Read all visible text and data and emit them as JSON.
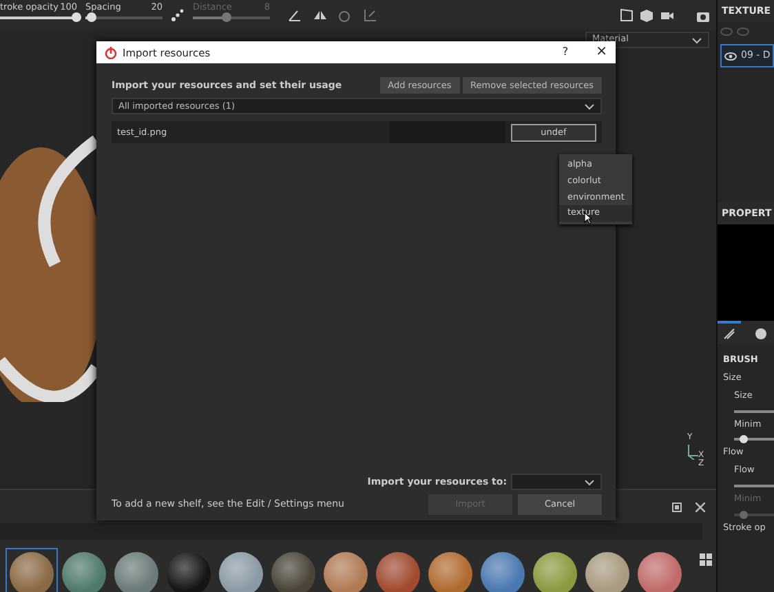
{
  "toolbar": {
    "sliders": [
      {
        "label": "troke opacity",
        "value": "100",
        "level": 0.98,
        "disabled": false
      },
      {
        "label": "Spacing",
        "value": "20",
        "level": 0.08,
        "disabled": false
      },
      {
        "label": "Distance",
        "value": "8",
        "level": 0.42,
        "disabled": true
      }
    ]
  },
  "material_select": {
    "value": "Material"
  },
  "axis_gizmo": {
    "labels": [
      "Y",
      "X",
      "Z"
    ]
  },
  "texture_panel": {
    "title": "TEXTURE",
    "layers": [
      {
        "label": "09 - D",
        "selected": true
      }
    ]
  },
  "properties_panel": {
    "title": "PROPERT",
    "tabs": [
      {
        "kind": "brush",
        "selected": true
      },
      {
        "kind": "material",
        "selected": false
      }
    ],
    "section": "BRUSH",
    "params": [
      {
        "kind": "group",
        "label": "Size"
      },
      {
        "kind": "slider",
        "label": "Size",
        "disabled": false
      },
      {
        "kind": "slider",
        "label": "Minim",
        "level": 0.25,
        "disabled": false
      },
      {
        "kind": "group",
        "label": "Flow"
      },
      {
        "kind": "slider",
        "label": "Flow",
        "disabled": false
      },
      {
        "kind": "slider",
        "label": "Minim",
        "level": 0.25,
        "disabled": true
      },
      {
        "kind": "group",
        "label": "Stroke op"
      }
    ]
  },
  "dialog": {
    "title": "Import resources",
    "help": "?",
    "close": "×",
    "heading": "Import your resources and set their usage",
    "buttons": [
      {
        "label": "Add resources"
      },
      {
        "label": "Remove selected resources"
      }
    ],
    "filter": {
      "value": "All imported resources (1)"
    },
    "resources": [
      {
        "name": "test_id.png",
        "usage": "undef"
      }
    ],
    "usage_menu": [
      {
        "label": "alpha",
        "selected": false
      },
      {
        "label": "colorlut",
        "selected": false
      },
      {
        "label": "environment",
        "selected": false
      },
      {
        "label": "texture",
        "selected": true
      }
    ],
    "destination_label": "Import your resources to:",
    "hint": "To add a new shelf, see the Edit / Settings menu",
    "actions": [
      {
        "label": "Import",
        "disabled": true
      },
      {
        "label": "Cancel",
        "disabled": false
      }
    ]
  },
  "shelf": {
    "materials": [
      {
        "color": "#8a6a45",
        "selected": true
      },
      {
        "color": "#4f7a6a",
        "selected": false
      },
      {
        "color": "#6a7a78",
        "selected": false
      },
      {
        "color": "#151515",
        "selected": false
      },
      {
        "color": "#8a9aa5",
        "selected": false
      },
      {
        "color": "#4a4438",
        "selected": false
      },
      {
        "color": "#b07a55",
        "selected": false
      },
      {
        "color": "#a04a30",
        "selected": false
      },
      {
        "color": "#b06a30",
        "selected": false
      },
      {
        "color": "#4a78b0",
        "selected": false
      },
      {
        "color": "#8a9a40",
        "selected": false
      },
      {
        "color": "#a89a80",
        "selected": false
      },
      {
        "color": "#c06a6a",
        "selected": false
      }
    ]
  }
}
